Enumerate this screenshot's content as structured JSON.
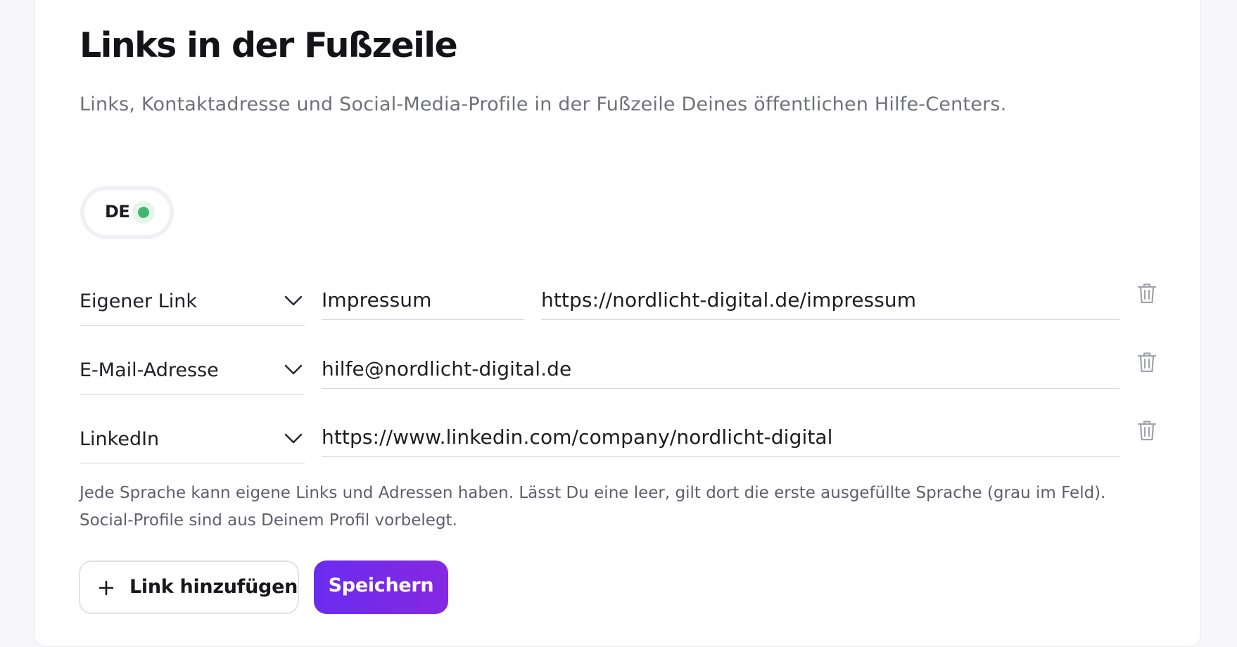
{
  "section": {
    "title": "Links in der Fußzeile",
    "subtitle": "Links, Kontaktadresse und Social-Media-Profile in der Fußzeile Deines öffentlichen Hilfe-Centers."
  },
  "language_tab": {
    "code": "DE",
    "status_color": "#43b86c"
  },
  "links": [
    {
      "type": "Eigener Link",
      "label": "Impressum",
      "value": "https://nordlicht-digital.de/impressum"
    },
    {
      "type": "E-Mail-Adresse",
      "value": "hilfe@nordlicht-digital.de"
    },
    {
      "type": "LinkedIn",
      "value": "https://www.linkedin.com/company/nordlicht-digital"
    }
  ],
  "hint": "Jede Sprache kann eigene Links und Adressen haben. Lässt Du eine leer, gilt dort die erste ausgefüllte Sprache (grau im Feld). Social-Profile sind aus Deinem Profil vorbelegt.",
  "actions": {
    "add_label": "Link hinzufügen",
    "save_label": "Speichern"
  },
  "colors": {
    "accent_start": "#6a2cf0",
    "accent_end": "#8628e0"
  },
  "icons": {
    "dropdown": "chevron-down-icon",
    "delete": "trash-icon",
    "add": "plus-icon"
  }
}
